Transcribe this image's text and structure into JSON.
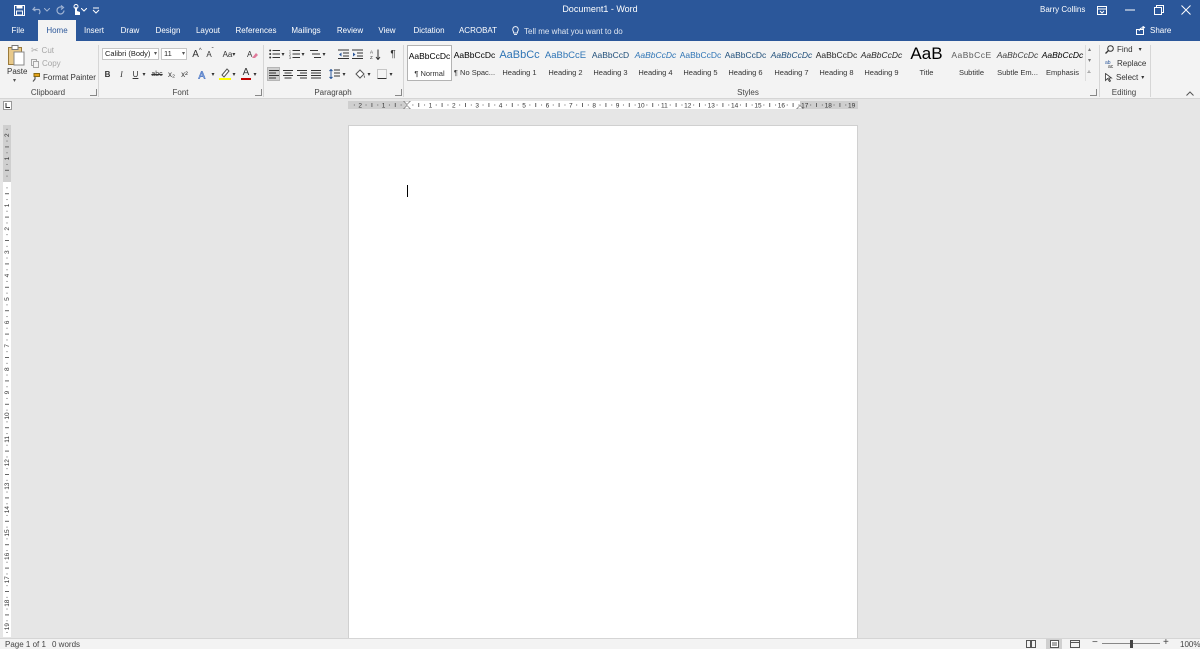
{
  "titlebar": {
    "doc_title": "Document1 - Word",
    "user": "Barry Collins",
    "quick_access": [
      "save-icon",
      "undo-icon",
      "redo-icon",
      "touch-mode-icon",
      "customize-icon"
    ]
  },
  "tabs": [
    {
      "label": "File"
    },
    {
      "label": "Home"
    },
    {
      "label": "Insert"
    },
    {
      "label": "Draw"
    },
    {
      "label": "Design"
    },
    {
      "label": "Layout"
    },
    {
      "label": "References"
    },
    {
      "label": "Mailings"
    },
    {
      "label": "Review"
    },
    {
      "label": "View"
    },
    {
      "label": "Dictation"
    },
    {
      "label": "ACROBAT"
    }
  ],
  "active_tab": "Home",
  "tell_me": "Tell me what you want to do",
  "share": "Share",
  "clipboard": {
    "paste": "Paste",
    "cut": "Cut",
    "copy": "Copy",
    "format_painter": "Format Painter",
    "label": "Clipboard"
  },
  "font": {
    "name": "Calibri (Body)",
    "size": "11",
    "label": "Font",
    "case": "Aa",
    "bold": "B",
    "italic": "I",
    "underline": "U",
    "strike": "abc",
    "subscript": "x₂",
    "superscript": "x²",
    "grow": "A",
    "shrink": "A",
    "font_color": "A"
  },
  "paragraph": {
    "label": "Paragraph",
    "pilcrow": "¶"
  },
  "styles": {
    "label": "Styles",
    "items": [
      {
        "sample": "AaBbCcDc",
        "name": "¶ Normal"
      },
      {
        "sample": "AaBbCcDc",
        "name": "¶ No Spac..."
      },
      {
        "sample": "AaBbCc",
        "name": "Heading 1"
      },
      {
        "sample": "AaBbCcE",
        "name": "Heading 2"
      },
      {
        "sample": "AaBbCcD",
        "name": "Heading 3"
      },
      {
        "sample": "AaBbCcDc",
        "name": "Heading 4"
      },
      {
        "sample": "AaBbCcDc",
        "name": "Heading 5"
      },
      {
        "sample": "AaBbCcDc",
        "name": "Heading 6"
      },
      {
        "sample": "AaBbCcDc",
        "name": "Heading 7"
      },
      {
        "sample": "AaBbCcDc",
        "name": "Heading 8"
      },
      {
        "sample": "AaBbCcDc",
        "name": "Heading 9"
      },
      {
        "sample": "AaB",
        "name": "Title"
      },
      {
        "sample": "AaBbCcE",
        "name": "Subtitle"
      },
      {
        "sample": "AaBbCcDc",
        "name": "Subtle Em..."
      },
      {
        "sample": "AaBbCcDc",
        "name": "Emphasis"
      }
    ]
  },
  "editing": {
    "label": "Editing",
    "find": "Find",
    "replace": "Replace",
    "select": "Select"
  },
  "ruler_h_labels": [
    "2",
    "1",
    "1",
    "2",
    "3",
    "4",
    "5",
    "6",
    "7",
    "8",
    "9",
    "10",
    "11",
    "12",
    "13",
    "14",
    "15",
    "16",
    "17",
    "18",
    "19"
  ],
  "ruler_v_labels": [
    "2",
    "1",
    "1",
    "2",
    "3",
    "4",
    "5",
    "6",
    "7",
    "8",
    "9",
    "10",
    "11",
    "12",
    "13",
    "14",
    "15",
    "16",
    "17",
    "18",
    "19"
  ],
  "status": {
    "page": "Page 1 of 1",
    "words": "0 words",
    "zoom": "100%"
  },
  "colors": {
    "accent": "#2b579a",
    "ribbon": "#f3f3f3",
    "canvas": "#e6e6e6",
    "font_color": "#c00000",
    "highlight": "#ffff00"
  }
}
